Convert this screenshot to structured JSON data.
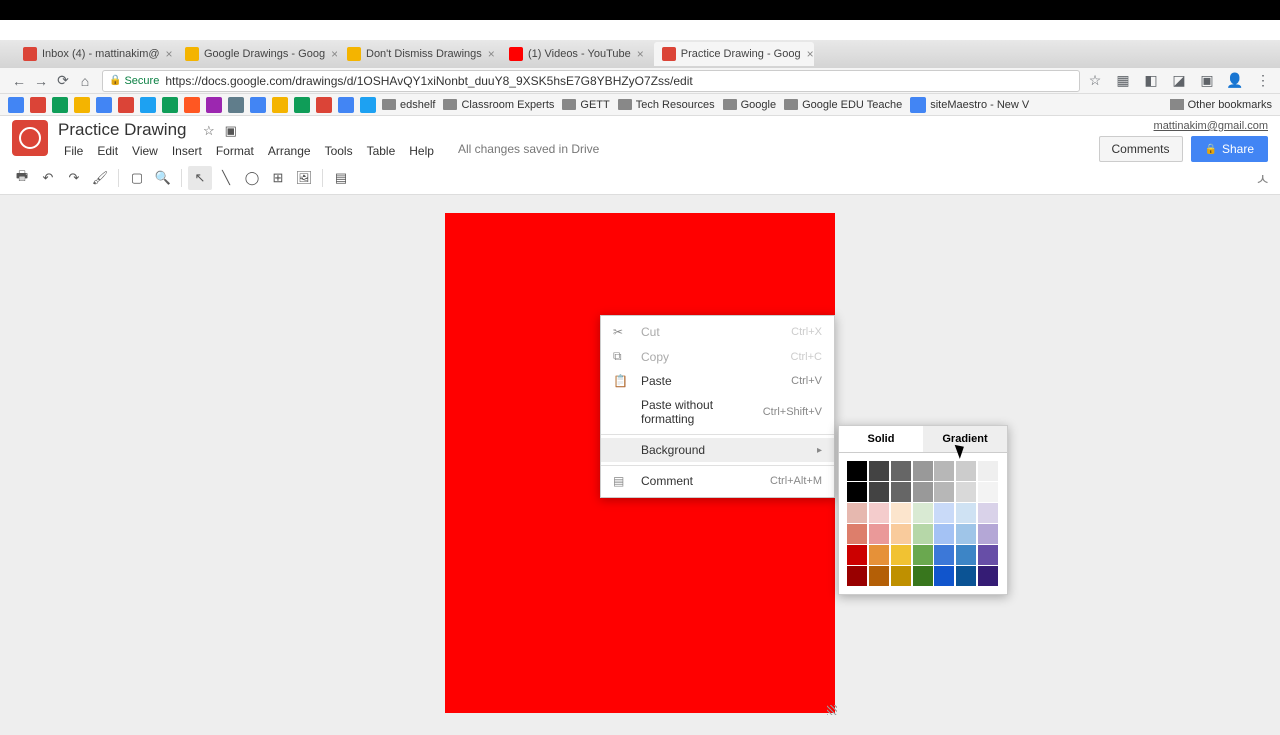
{
  "tabs": [
    {
      "label": "Inbox (4) - mattinakim@",
      "favicon": "#db4437"
    },
    {
      "label": "Google Drawings - Goog",
      "favicon": "#f4b400"
    },
    {
      "label": "Don't Dismiss Drawings",
      "favicon": "#f4b400"
    },
    {
      "label": "(1) Videos - YouTube",
      "favicon": "#ff0000"
    },
    {
      "label": "Practice Drawing - Goog",
      "favicon": "#db4437",
      "active": true
    }
  ],
  "addressbar": {
    "secure_label": "Secure",
    "url": "https://docs.google.com/drawings/d/1OSHAvQY1xiNonbt_duuY8_9XSK5hsE7G8YBHZyO7Zss/edit"
  },
  "bookmarks": {
    "items": [
      "edshelf",
      "Classroom Experts",
      "GETT",
      "Tech Resources",
      "Google",
      "Google EDU Teache",
      "siteMaestro - New V"
    ],
    "other": "Other bookmarks"
  },
  "app": {
    "doc_title": "Practice Drawing",
    "menus": [
      "File",
      "Edit",
      "View",
      "Insert",
      "Format",
      "Arrange",
      "Tools",
      "Table",
      "Help"
    ],
    "save_status": "All changes saved in Drive",
    "user_email": "mattinakim@gmail.com",
    "comments_btn": "Comments",
    "share_btn": "Share"
  },
  "context_menu": {
    "items": [
      {
        "label": "Cut",
        "shortcut": "Ctrl+X",
        "icon": "✂",
        "disabled": true
      },
      {
        "label": "Copy",
        "shortcut": "Ctrl+C",
        "icon": "⧉",
        "disabled": true
      },
      {
        "label": "Paste",
        "shortcut": "Ctrl+V",
        "icon": "📋"
      },
      {
        "label": "Paste without formatting",
        "shortcut": "Ctrl+Shift+V",
        "icon": ""
      },
      {
        "sep": true
      },
      {
        "label": "Background",
        "submenu": true,
        "hover": true
      },
      {
        "sep": true
      },
      {
        "label": "Comment",
        "shortcut": "Ctrl+Alt+M",
        "icon": "▤"
      }
    ]
  },
  "color_picker": {
    "tabs": {
      "solid": "Solid",
      "gradient": "Gradient"
    },
    "swatches": [
      "#000000",
      "#434343",
      "#666666",
      "#999999",
      "#b7b7b7",
      "#cccccc",
      "#efefef",
      "#000000",
      "#434343",
      "#666666",
      "#999999",
      "#b7b7b7",
      "#d9d9d9",
      "#f3f3f3",
      "#e6b8af",
      "#f4cccc",
      "#fce5cd",
      "#d9ead3",
      "#c9daf8",
      "#cfe2f3",
      "#d9d2e9",
      "#dd7e6b",
      "#ea9999",
      "#f9cb9c",
      "#b6d7a8",
      "#a4c2f4",
      "#9fc5e8",
      "#b4a7d6",
      "#cc0000",
      "#e69138",
      "#f1c232",
      "#6aa84f",
      "#3c78d8",
      "#3d85c6",
      "#674ea7",
      "#990000",
      "#b45f06",
      "#bf9000",
      "#38761d",
      "#1155cc",
      "#0b5394",
      "#351c75"
    ]
  }
}
